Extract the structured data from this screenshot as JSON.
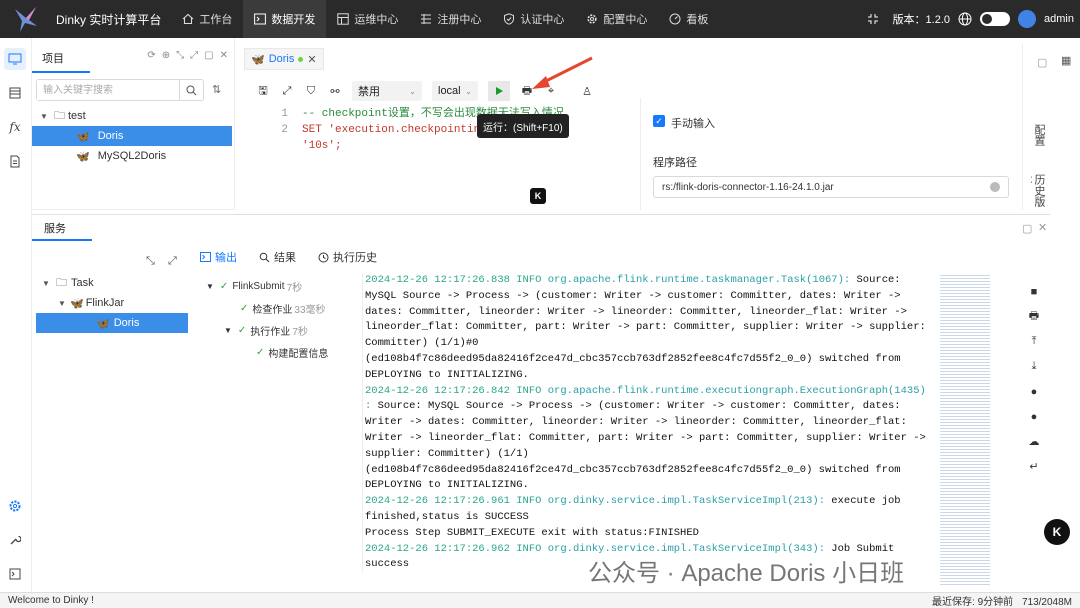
{
  "app": {
    "name": "Dinky 实时计算平台"
  },
  "nav": [
    {
      "label": "工作台",
      "icon": "home-icon"
    },
    {
      "label": "数据开发",
      "icon": "terminal-icon",
      "active": true
    },
    {
      "label": "运维中心",
      "icon": "grid-icon"
    },
    {
      "label": "注册中心",
      "icon": "register-icon"
    },
    {
      "label": "认证中心",
      "icon": "shield-icon"
    },
    {
      "label": "配置中心",
      "icon": "gear-icon"
    },
    {
      "label": "看板",
      "icon": "dashboard-icon"
    }
  ],
  "header": {
    "version": "版本：1.2.0",
    "user": "admin"
  },
  "project": {
    "title": "项目",
    "search_placeholder": "输入关键字搜索",
    "tree": [
      {
        "label": "test",
        "type": "folder"
      },
      {
        "label": "Doris",
        "type": "task",
        "selected": true
      },
      {
        "label": "MySQL2Doris",
        "type": "task"
      }
    ]
  },
  "editor": {
    "tab_label": "Doris",
    "toolbar": {
      "mode": "禁用",
      "env": "local"
    },
    "tooltip": "运行：(Shift+F10)",
    "lines": [
      {
        "no": "1",
        "text": "-- checkpoint设置，不写会出现数据无法写入情况"
      },
      {
        "no": "2",
        "text": "SET 'execution.checkpointing.interval' = "
      },
      {
        "no": "",
        "text": "'10s';"
      }
    ]
  },
  "props": {
    "manual_input": "手动输入",
    "path_label": "程序路径",
    "path_value": "rs:/flink-doris-connector-1.16-24.1.0.jar"
  },
  "right_tabs": [
    "配置",
    "历史版本"
  ],
  "services": {
    "title": "服务",
    "tree": [
      {
        "label": "Task",
        "level": 0
      },
      {
        "label": "FlinkJar",
        "level": 1
      },
      {
        "label": "Doris",
        "level": 2,
        "selected": true
      }
    ],
    "tabs": [
      "输出",
      "结果",
      "执行历史"
    ],
    "jobs": [
      {
        "label": "FlinkSubmit",
        "dur": "7秒",
        "level": 0
      },
      {
        "label": "检查作业",
        "dur": "33毫秒",
        "level": 1
      },
      {
        "label": "执行作业",
        "dur": "7秒",
        "level": 1
      },
      {
        "label": "构建配置信息",
        "dur": "",
        "level": 2
      }
    ],
    "log": [
      {
        "ts": "2024-12-26 12:17:26.838 INFO",
        "cls": "org.apache.flink.runtime.taskmanager.Task(1067):",
        "msg": " Source:"
      },
      {
        "text": "MySQL Source -> Process -> (customer: Writer -> customer: Committer, dates: Writer ->"
      },
      {
        "text": "dates: Committer, lineorder: Writer -> lineorder: Committer, lineorder_flat: Writer ->"
      },
      {
        "text": "lineorder_flat: Committer, part: Writer -> part: Committer, supplier: Writer -> supplier:"
      },
      {
        "text": "Committer) (1/1)#0"
      },
      {
        "text": "(ed108b4f7c86deed95da82416f2ce47d_cbc357ccb763df2852fee8c4fc7d55f2_0_0) switched from"
      },
      {
        "text": "DEPLOYING to INITIALIZING."
      },
      {
        "ts": "2024-12-26 12:17:26.842 INFO",
        "cls": "org.apache.flink.runtime.executiongraph.ExecutionGraph(1435)",
        "msg": ""
      },
      {
        "cls": ":",
        "msg": " Source: MySQL Source -> Process -> (customer: Writer -> customer: Committer, dates:"
      },
      {
        "text": "Writer -> dates: Committer, lineorder: Writer -> lineorder: Committer, lineorder_flat:"
      },
      {
        "text": "Writer -> lineorder_flat: Committer, part: Writer -> part: Committer, supplier: Writer ->"
      },
      {
        "text": "supplier: Committer) (1/1)"
      },
      {
        "text": "(ed108b4f7c86deed95da82416f2ce47d_cbc357ccb763df2852fee8c4fc7d55f2_0_0) switched from"
      },
      {
        "text": "DEPLOYING to INITIALIZING."
      },
      {
        "ts": "2024-12-26 12:17:26.961 INFO",
        "cls": "org.dinky.service.impl.TaskServiceImpl(213):",
        "msg": " execute job"
      },
      {
        "text": "finished,status is SUCCESS"
      },
      {
        "text": "Process Step SUBMIT_EXECUTE exit with status:FINISHED"
      },
      {
        "ts": "2024-12-26 12:17:26.962 INFO",
        "cls": "org.dinky.service.impl.TaskServiceImpl(343):",
        "msg": " Job Submit"
      },
      {
        "text": "success"
      }
    ]
  },
  "watermark": "公众号 · Apache Doris 小日班",
  "status": {
    "welcome": "Welcome to Dinky !",
    "autosave": "最近保存: 9分钟前",
    "memory": "713/2048M"
  }
}
